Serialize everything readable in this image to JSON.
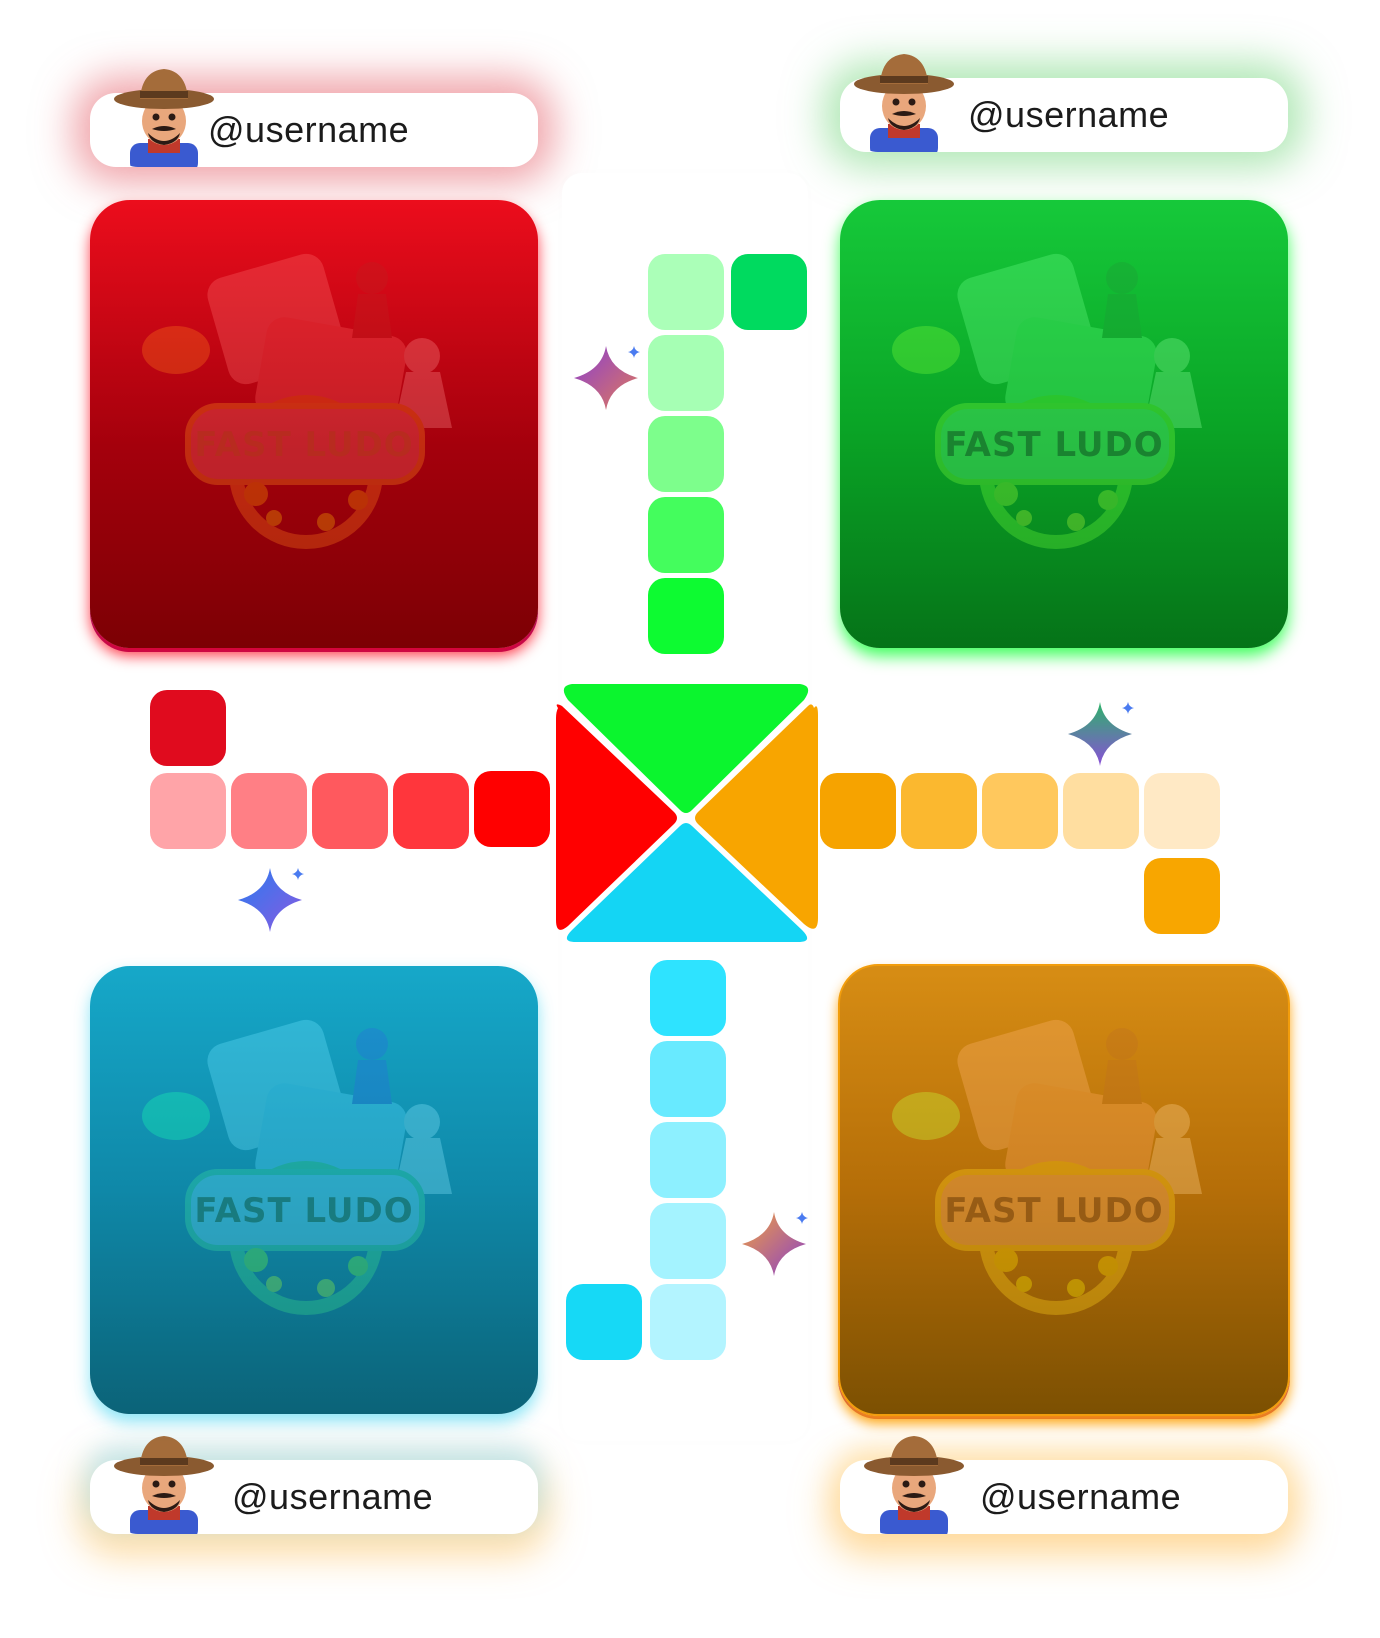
{
  "players": [
    {
      "id": "red",
      "username": "@username",
      "color": "#e90b1a"
    },
    {
      "id": "green",
      "username": "@username",
      "color": "#0bc52e"
    },
    {
      "id": "blue",
      "username": "@username",
      "color": "#14a6c7"
    },
    {
      "id": "yellow",
      "username": "@username",
      "color": "#f6a300"
    }
  ],
  "logo_text": "FAST LUDO",
  "icons": {
    "avatar": "farmer-avatar-icon",
    "sparkle": "sparkle-icon",
    "logo": "fast-ludo-logo"
  },
  "palette": {
    "red_track": [
      "#ffa4a8",
      "#ff7f85",
      "#ff595e",
      "#ff363c",
      "#ff0000",
      "#e00b1e"
    ],
    "green_track": [
      "#a6ffb4",
      "#a6ffb4",
      "#7dfe8c",
      "#44fd5d",
      "#0dfb31",
      "#00da5f"
    ],
    "yellow_track": [
      "#f6a300",
      "#fbb82f",
      "#ffc85d",
      "#ffdea0",
      "#ffe9c5",
      "#f8a600"
    ],
    "blue_track": [
      "#2ee3ff",
      "#68eaff",
      "#8df0ff",
      "#a4f3ff",
      "#b3f4ff",
      "#16d9f6"
    ]
  }
}
